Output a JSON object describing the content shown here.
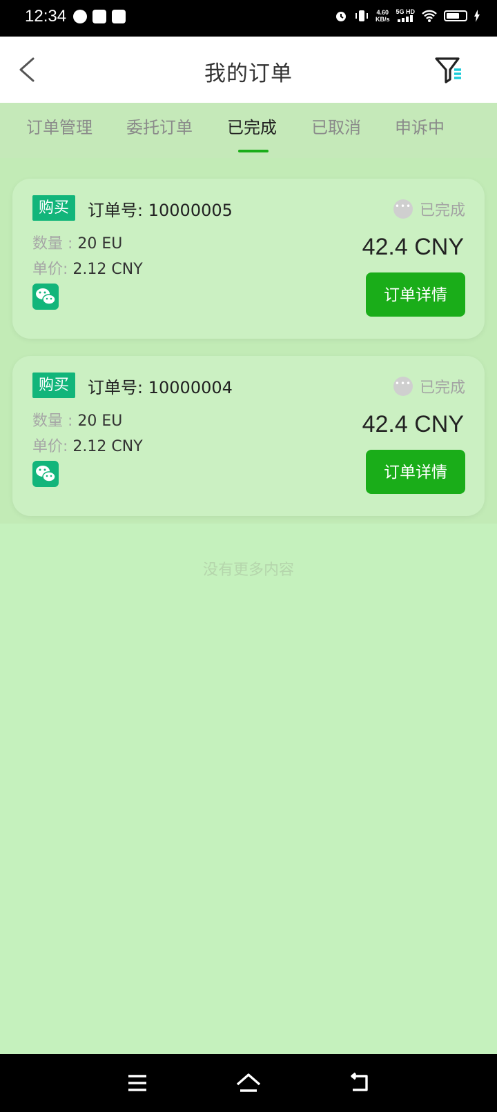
{
  "status_bar": {
    "time": "12:34",
    "net_speed": "4.60",
    "net_unit": "KB/s",
    "network": "5G HD"
  },
  "header": {
    "title": "我的订单",
    "back_icon": "back-icon",
    "filter_icon": "filter-icon"
  },
  "tabs": [
    {
      "label": "订单管理"
    },
    {
      "label": "委托订单"
    },
    {
      "label": "已完成"
    },
    {
      "label": "已取消"
    },
    {
      "label": "申诉中"
    }
  ],
  "active_tab": "已完成",
  "orders": [
    {
      "type": "购买",
      "order_no_label": "订单号:",
      "order_no": "10000005",
      "status": "已完成",
      "qty_label": "数量 :",
      "qty": "20 EU",
      "price_label": "单价:",
      "price": "2.12 CNY",
      "total": "42.4 CNY",
      "payment_icon": "wechat-pay-icon",
      "detail_label": "订单详情"
    },
    {
      "type": "购买",
      "order_no_label": "订单号:",
      "order_no": "10000004",
      "status": "已完成",
      "qty_label": "数量 :",
      "qty": "20 EU",
      "price_label": "单价:",
      "price": "2.12 CNY",
      "total": "42.4 CNY",
      "payment_icon": "wechat-pay-icon",
      "detail_label": "订单详情"
    }
  ],
  "footer_text": "没有更多内容",
  "colors": {
    "accent": "#1aad19",
    "badge": "#12b57a",
    "background": "#c5f1bd"
  }
}
